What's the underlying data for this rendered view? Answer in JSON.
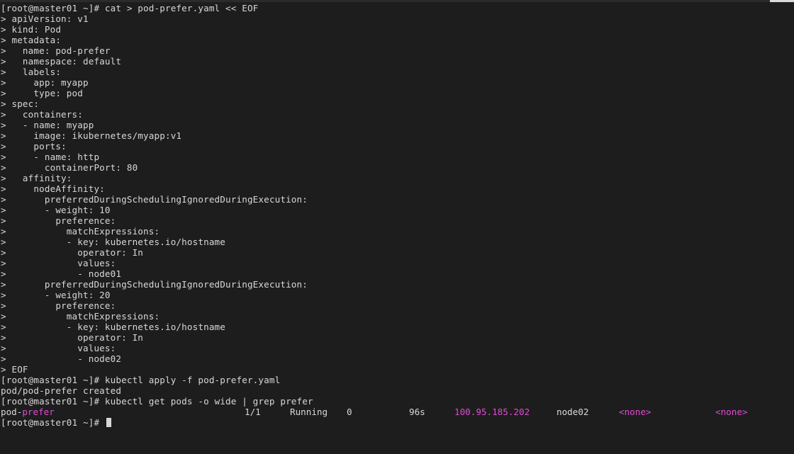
{
  "colors": {
    "background": "#1d1d1d",
    "text": "#d8d8d8",
    "highlight": "#e04bd3"
  },
  "lines": [
    "[root@master01 ~]# cat > pod-prefer.yaml << EOF",
    "> apiVersion: v1",
    "> kind: Pod",
    "> metadata:",
    ">   name: pod-prefer",
    ">   namespace: default",
    ">   labels:",
    ">     app: myapp",
    ">     type: pod",
    "> spec:",
    ">   containers:",
    ">   - name: myapp",
    ">     image: ikubernetes/myapp:v1",
    ">     ports:",
    ">     - name: http",
    ">       containerPort: 80",
    ">   affinity:",
    ">     nodeAffinity:",
    ">       preferredDuringSchedulingIgnoredDuringExecution:",
    ">       - weight: 10",
    ">         preference:",
    ">           matchExpressions:",
    ">           - key: kubernetes.io/hostname",
    ">             operator: In",
    ">             values:",
    ">             - node01",
    ">       preferredDuringSchedulingIgnoredDuringExecution:",
    ">       - weight: 20",
    ">         preference:",
    ">           matchExpressions:",
    ">           - key: kubernetes.io/hostname",
    ">             operator: In",
    ">             values:",
    ">             - node02",
    "> EOF",
    "[root@master01 ~]# kubectl apply -f pod-prefer.yaml",
    "pod/pod-prefer created",
    "[root@master01 ~]# kubectl get pods -o wide | grep prefer"
  ],
  "pod_row": {
    "name_prefix": "pod-",
    "name_match": "prefer",
    "ready": "1/1",
    "status": "Running",
    "restarts": "0",
    "age": "96s",
    "ip": "100.95.185.202",
    "node": "node02",
    "nominated_node": "<none>",
    "readiness_gates": "<none>"
  },
  "prompt": "[root@master01 ~]# "
}
